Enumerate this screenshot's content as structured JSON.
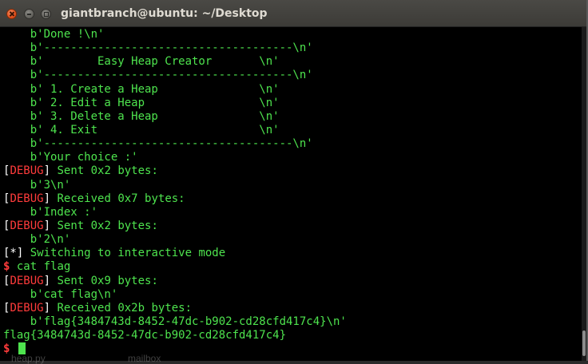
{
  "window": {
    "title": "giantbranch@ubuntu: ~/Desktop"
  },
  "terminal": {
    "lines": [
      [
        {
          "t": "    b'Done !\\n'",
          "c": "out"
        }
      ],
      [
        {
          "t": "    b'-------------------------------------\\n'",
          "c": "out"
        }
      ],
      [
        {
          "t": "    b'        Easy Heap Creator       \\n'",
          "c": "out"
        }
      ],
      [
        {
          "t": "    b'-------------------------------------\\n'",
          "c": "out"
        }
      ],
      [
        {
          "t": "    b' 1. Create a Heap               \\n'",
          "c": "out"
        }
      ],
      [
        {
          "t": "    b' 2. Edit a Heap                 \\n'",
          "c": "out"
        }
      ],
      [
        {
          "t": "    b' 3. Delete a Heap               \\n'",
          "c": "out"
        }
      ],
      [
        {
          "t": "    b' 4. Exit                        \\n'",
          "c": "out"
        }
      ],
      [
        {
          "t": "    b'-------------------------------------\\n'",
          "c": "out"
        }
      ],
      [
        {
          "t": "    b'Your choice :'",
          "c": "out"
        }
      ],
      [
        {
          "t": "[",
          "c": "prefix"
        },
        {
          "t": "DEBUG",
          "c": "dbg"
        },
        {
          "t": "]",
          "c": "prefix"
        },
        {
          "t": " Sent 0x2 bytes:",
          "c": "out"
        }
      ],
      [
        {
          "t": "    b'3\\n'",
          "c": "out"
        }
      ],
      [
        {
          "t": "[",
          "c": "prefix"
        },
        {
          "t": "DEBUG",
          "c": "dbg"
        },
        {
          "t": "]",
          "c": "prefix"
        },
        {
          "t": " Received 0x7 bytes:",
          "c": "out"
        }
      ],
      [
        {
          "t": "    b'Index :'",
          "c": "out"
        }
      ],
      [
        {
          "t": "[",
          "c": "prefix"
        },
        {
          "t": "DEBUG",
          "c": "dbg"
        },
        {
          "t": "]",
          "c": "prefix"
        },
        {
          "t": " Sent 0x2 bytes:",
          "c": "out"
        }
      ],
      [
        {
          "t": "    b'2\\n'",
          "c": "out"
        }
      ],
      [
        {
          "t": "[*]",
          "c": "prefix"
        },
        {
          "t": " Switching to interactive mode",
          "c": "out"
        }
      ],
      [
        {
          "t": "$",
          "c": "prompt"
        },
        {
          "t": " cat flag",
          "c": "out"
        }
      ],
      [
        {
          "t": "[",
          "c": "prefix"
        },
        {
          "t": "DEBUG",
          "c": "dbg"
        },
        {
          "t": "]",
          "c": "prefix"
        },
        {
          "t": " Sent 0x9 bytes:",
          "c": "out"
        }
      ],
      [
        {
          "t": "    b'cat flag\\n'",
          "c": "out"
        }
      ],
      [
        {
          "t": "[",
          "c": "prefix"
        },
        {
          "t": "DEBUG",
          "c": "dbg"
        },
        {
          "t": "]",
          "c": "prefix"
        },
        {
          "t": " Received 0x2b bytes:",
          "c": "out"
        }
      ],
      [
        {
          "t": "    b'flag{3484743d-8452-47dc-b902-cd28cfd417c4}\\n'",
          "c": "out"
        }
      ],
      [
        {
          "t": "flag{3484743d-8452-47dc-b902-cd28cfd417c4}",
          "c": "out"
        }
      ],
      [
        {
          "t": "$",
          "c": "prompt"
        },
        {
          "t": " ",
          "c": "out"
        }
      ]
    ]
  },
  "taskbar_peek": {
    "items": [
      "heap.py",
      "mailbox"
    ]
  },
  "colors": {
    "terminal_bg": "#000000",
    "output_green": "#4ee44e",
    "debug_red": "#ff3b3b",
    "bracket_white": "#ffffff",
    "titlebar": "#3c3b37",
    "close_button": "#dd4814"
  },
  "icons": {
    "close": "close-icon",
    "minimize": "minimize-icon",
    "maximize": "maximize-icon"
  }
}
